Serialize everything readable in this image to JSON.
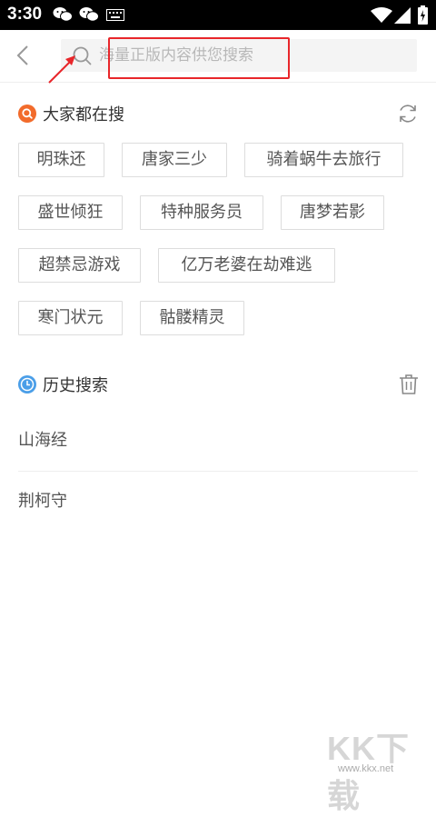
{
  "status_bar": {
    "time": "3:30",
    "icons": [
      "wechat-icon",
      "wechat-icon",
      "keyboard-icon",
      "wifi-icon",
      "signal-icon",
      "battery-icon"
    ]
  },
  "search": {
    "placeholder": "海量正版内容供您搜索",
    "value": ""
  },
  "hot": {
    "title": "大家都在搜",
    "tags": [
      "明珠还",
      "唐家三少",
      "骑着蜗牛去旅行",
      "盛世倾狂",
      "特种服务员",
      "唐梦若影",
      "超禁忌游戏",
      "亿万老婆在劫难逃",
      "寒门状元",
      "骷髅精灵"
    ]
  },
  "history": {
    "title": "历史搜索",
    "items": [
      "山海经",
      "荆柯守"
    ]
  },
  "colors": {
    "accent": "#f26b2b",
    "history_icon": "#4a9ee8",
    "annotation": "#e8262a"
  },
  "watermark": {
    "brand": "KK下载",
    "url": "www.kkx.net"
  }
}
